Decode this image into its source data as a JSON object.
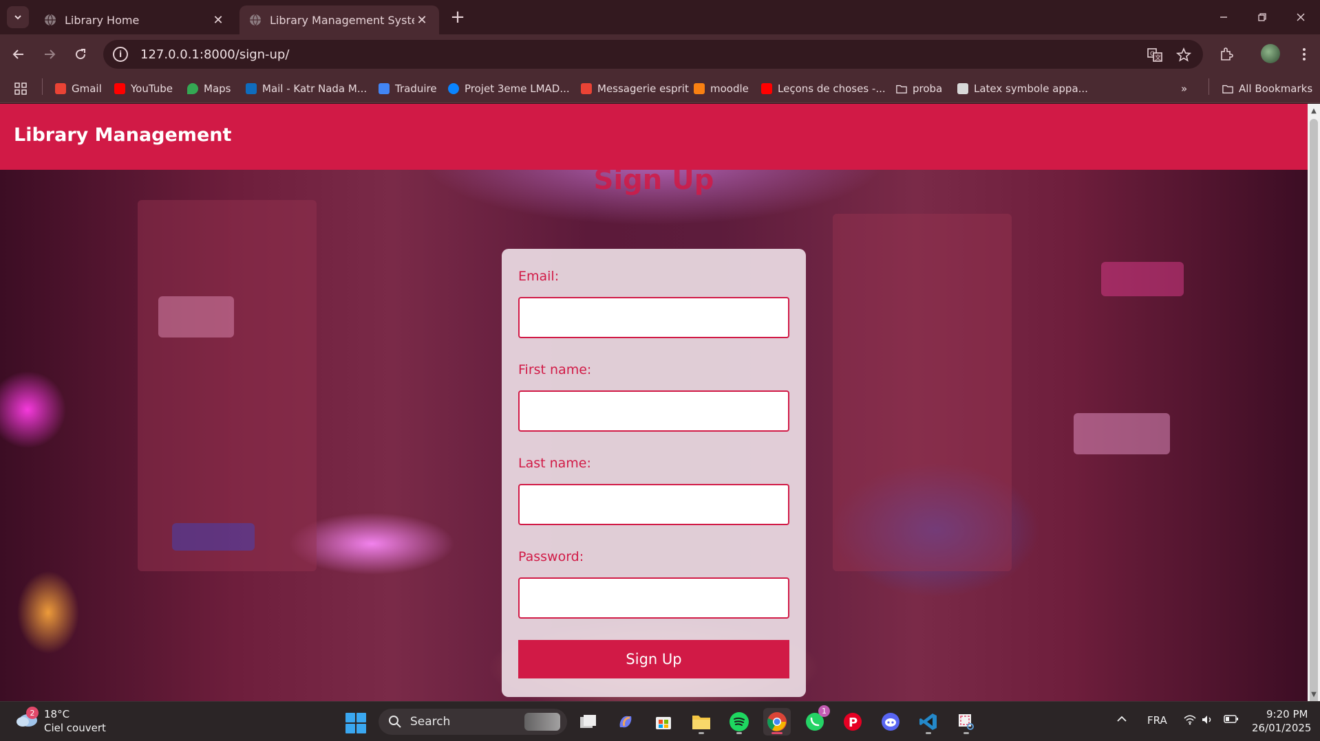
{
  "browser": {
    "tabs": [
      {
        "title": "Library Home",
        "active": false
      },
      {
        "title": "Library Management System",
        "active": true
      }
    ],
    "url": "127.0.0.1:8000/sign-up/",
    "bookmarks": [
      {
        "label": "Gmail",
        "icon": "gmail-icon",
        "color": "#ea4335"
      },
      {
        "label": "YouTube",
        "icon": "youtube-icon",
        "color": "#ff0000"
      },
      {
        "label": "Maps",
        "icon": "maps-icon",
        "color": "#34a853"
      },
      {
        "label": "Mail - Katr Nada M...",
        "icon": "outlook-icon",
        "color": "#0f6cbd"
      },
      {
        "label": "Traduire",
        "icon": "translate-icon",
        "color": "#4285f4"
      },
      {
        "label": "Projet 3eme LMAD...",
        "icon": "onedrive-icon",
        "color": "#0a84ff"
      },
      {
        "label": "Messagerie esprit",
        "icon": "gmail-icon",
        "color": "#ea4335"
      },
      {
        "label": "moodle",
        "icon": "moodle-icon",
        "color": "#f98012"
      },
      {
        "label": "Leçons de choses -...",
        "icon": "youtube-icon",
        "color": "#ff0000"
      },
      {
        "label": "proba",
        "icon": "folder-icon",
        "color": "#eadbde"
      },
      {
        "label": "Latex symbole appa...",
        "icon": "latex-icon",
        "color": "#d8d8d8"
      }
    ],
    "all_bookmarks": "All Bookmarks"
  },
  "page": {
    "brand": "Library Management",
    "heading": "Sign Up",
    "form": {
      "email_label": "Email:",
      "first_name_label": "First name:",
      "last_name_label": "Last name:",
      "password_label": "Password:",
      "email_value": "",
      "first_name_value": "",
      "last_name_value": "",
      "password_value": "",
      "submit_label": "Sign Up"
    },
    "colors": {
      "accent": "#d11a46",
      "card": "#ecdce4"
    }
  },
  "taskbar": {
    "weather_temp": "18°C",
    "weather_desc": "Ciel couvert",
    "weather_badge": "2",
    "search_label": "Search",
    "whatsapp_badge": "1",
    "language": "FRA",
    "time": "9:20 PM",
    "date": "26/01/2025"
  }
}
